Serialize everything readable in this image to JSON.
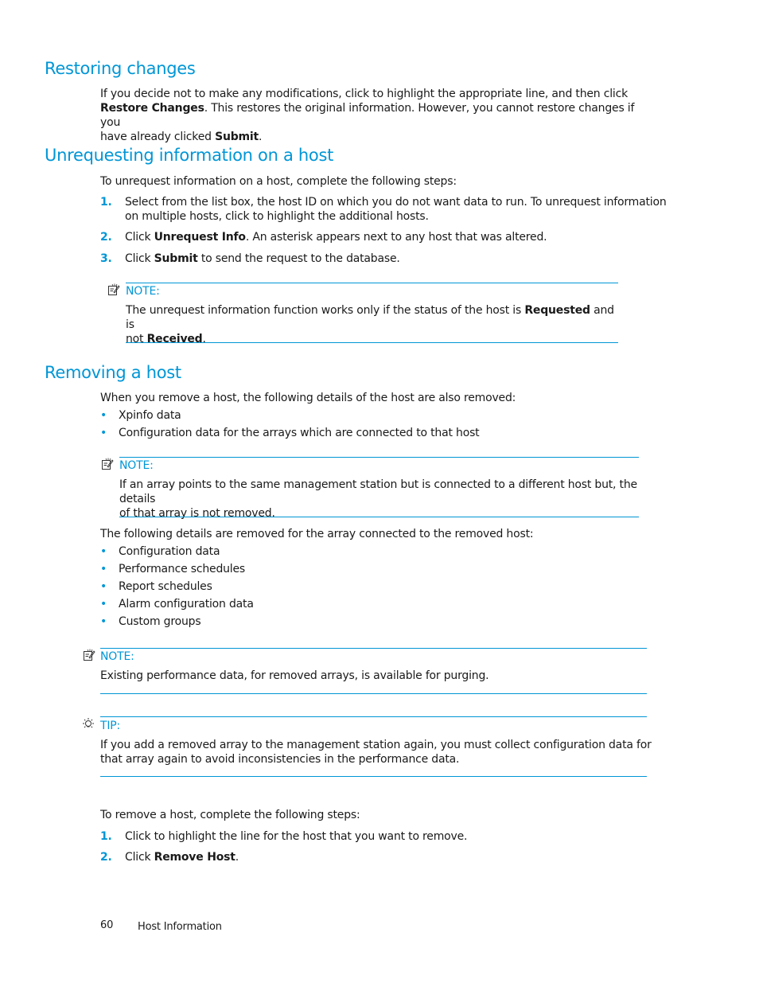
{
  "sections": {
    "restoring": {
      "title": "Restoring changes",
      "para": {
        "t1": "If you decide not to make any modifications, click to highlight the appropriate line, and then click",
        "b1": "Restore Changes",
        "t2": ".  This restores the original information.  However, you cannot restore changes if you",
        "t3": "have already clicked ",
        "b2": "Submit",
        "t4": "."
      }
    },
    "unrequesting": {
      "title": "Unrequesting information on a host",
      "intro": "To unrequest information on a host, complete the following steps:",
      "steps": [
        {
          "num": "1.",
          "line1": "Select from the list box, the host ID on which you do not want data to run.  To unrequest information",
          "line2": "on multiple hosts, click to highlight the additional hosts."
        },
        {
          "num": "2.",
          "pre": "Click ",
          "bold": "Unrequest Info",
          "post": ".  An asterisk appears next to any host that was altered."
        },
        {
          "num": "3.",
          "pre": "Click ",
          "bold": "Submit",
          "post": " to send the request to the database."
        }
      ],
      "note": {
        "label": "NOTE:",
        "t1": "The unrequest information function works only if the status of the host is ",
        "b1": "Requested",
        "t2": " and is",
        "t3": "not ",
        "b2": "Received",
        "t4": "."
      }
    },
    "removing": {
      "title": "Removing a host",
      "intro": "When you remove a host, the following details of the host are also removed:",
      "bullets1": [
        "Xpinfo data",
        "Configuration data for the arrays which are connected to that host"
      ],
      "note1": {
        "label": "NOTE:",
        "line1": "If an array points to the same management station but is connected to a different host but, the details",
        "line2": "of that array is not removed."
      },
      "intro2": "The following details are removed for the array connected to the removed host:",
      "bullets2": [
        "Configuration data",
        "Performance schedules",
        "Report schedules",
        "Alarm configuration data",
        "Custom groups"
      ],
      "note2": {
        "label": "NOTE:",
        "text": "Existing performance data, for removed arrays, is available for purging."
      },
      "tip": {
        "label": "TIP:",
        "line1": "If you add a removed array to the management station again, you must collect configuration data for",
        "line2": "that array again to avoid inconsistencies in the performance data."
      },
      "intro3": "To remove a host, complete the following steps:",
      "steps": [
        {
          "num": "1.",
          "text": "Click to highlight the line for the host that you want to remove."
        },
        {
          "num": "2.",
          "pre": "Click ",
          "bold": "Remove Host",
          "post": "."
        }
      ]
    }
  },
  "footer": {
    "page_number": "60",
    "chapter": "Host Information"
  },
  "icons": {
    "note": "note-pencil-icon",
    "tip": "lightbulb-icon"
  },
  "colors": {
    "accent": "#0096d6",
    "text": "#1a1a1a"
  }
}
